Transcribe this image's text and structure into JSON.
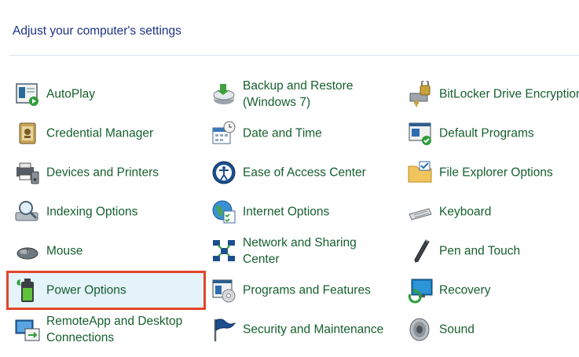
{
  "header": {
    "title": "Adjust your computer's settings"
  },
  "items": [
    {
      "label": "AutoPlay",
      "icon": "autoplay-icon"
    },
    {
      "label": "Backup and Restore\n(Windows 7)",
      "icon": "backup-restore-icon"
    },
    {
      "label": "BitLocker Drive Encryption",
      "icon": "bitlocker-icon"
    },
    {
      "label": "Credential Manager",
      "icon": "credential-manager-icon"
    },
    {
      "label": "Date and Time",
      "icon": "date-time-icon"
    },
    {
      "label": "Default Programs",
      "icon": "default-programs-icon"
    },
    {
      "label": "Devices and Printers",
      "icon": "devices-printers-icon"
    },
    {
      "label": "Ease of Access Center",
      "icon": "ease-of-access-icon"
    },
    {
      "label": "File Explorer Options",
      "icon": "file-explorer-options-icon"
    },
    {
      "label": "Indexing Options",
      "icon": "indexing-options-icon"
    },
    {
      "label": "Internet Options",
      "icon": "internet-options-icon"
    },
    {
      "label": "Keyboard",
      "icon": "keyboard-icon"
    },
    {
      "label": "Mouse",
      "icon": "mouse-icon"
    },
    {
      "label": "Network and Sharing\nCenter",
      "icon": "network-sharing-icon"
    },
    {
      "label": "Pen and Touch",
      "icon": "pen-touch-icon"
    },
    {
      "label": "Power Options",
      "icon": "power-options-icon",
      "highlighted": true
    },
    {
      "label": "Programs and Features",
      "icon": "programs-features-icon"
    },
    {
      "label": "Recovery",
      "icon": "recovery-icon"
    },
    {
      "label": "RemoteApp and Desktop\nConnections",
      "icon": "remoteapp-icon"
    },
    {
      "label": "Security and Maintenance",
      "icon": "security-maintenance-icon"
    },
    {
      "label": "Sound",
      "icon": "sound-icon"
    }
  ],
  "colors": {
    "link": "#155f2e",
    "heading": "#1e3287",
    "highlight_border": "#e2452a",
    "highlight_bg": "#e5f3fb"
  }
}
